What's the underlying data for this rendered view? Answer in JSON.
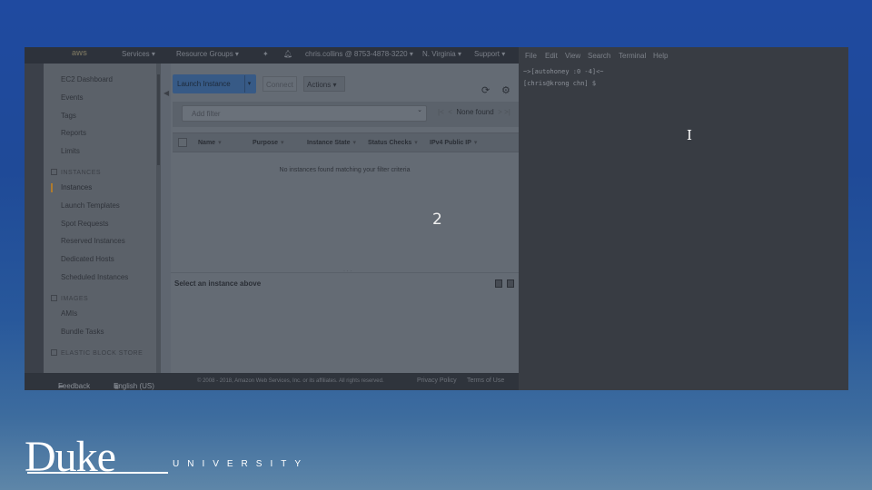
{
  "aws_header": {
    "logo": "aws",
    "services": "Services ▾",
    "resource_groups": "Resource Groups ▾",
    "account": "chris.collins @ 8753-4878-3220 ▾",
    "region": "N. Virginia ▾",
    "support": "Support ▾"
  },
  "sidebar": {
    "items": [
      {
        "label": "EC2 Dashboard"
      },
      {
        "label": "Events"
      },
      {
        "label": "Tags"
      },
      {
        "label": "Reports"
      },
      {
        "label": "Limits"
      }
    ],
    "section_instances": "INSTANCES",
    "instances_items": [
      {
        "label": "Instances"
      },
      {
        "label": "Launch Templates"
      },
      {
        "label": "Spot Requests"
      },
      {
        "label": "Reserved Instances"
      },
      {
        "label": "Dedicated Hosts"
      },
      {
        "label": "Scheduled Instances"
      }
    ],
    "section_images": "IMAGES",
    "images_items": [
      {
        "label": "AMIs"
      },
      {
        "label": "Bundle Tasks"
      }
    ],
    "section_ebs": "ELASTIC BLOCK STORE"
  },
  "toolbar": {
    "launch_label": "Launch Instance",
    "connect_label": "Connect",
    "actions_label": "Actions ▾"
  },
  "filter": {
    "placeholder": "Add filter",
    "pager_text": "None found"
  },
  "table": {
    "columns": [
      {
        "label": "Name"
      },
      {
        "label": "Purpose"
      },
      {
        "label": "Instance State"
      },
      {
        "label": "Status Checks"
      },
      {
        "label": "IPv4 Public IP"
      }
    ],
    "empty_message": "No instances found matching your filter criteria"
  },
  "detail_pane": {
    "label": "Select an instance above"
  },
  "aws_footer": {
    "feedback": "Feedback",
    "language": "English (US)",
    "copyright": "© 2008 - 2018, Amazon Web Services, Inc. or its affiliates. All rights reserved.",
    "privacy": "Privacy Policy",
    "terms": "Terms of Use"
  },
  "annotation_number": "2",
  "terminal": {
    "menu": [
      "File",
      "Edit",
      "View",
      "Search",
      "Terminal",
      "Help"
    ],
    "line1": "~>[autohoney :0 -4]<~",
    "line2": "[chris@krong chn] $"
  },
  "branding": {
    "wordmark": "Duke",
    "subtitle": "UNIVERSITY"
  }
}
